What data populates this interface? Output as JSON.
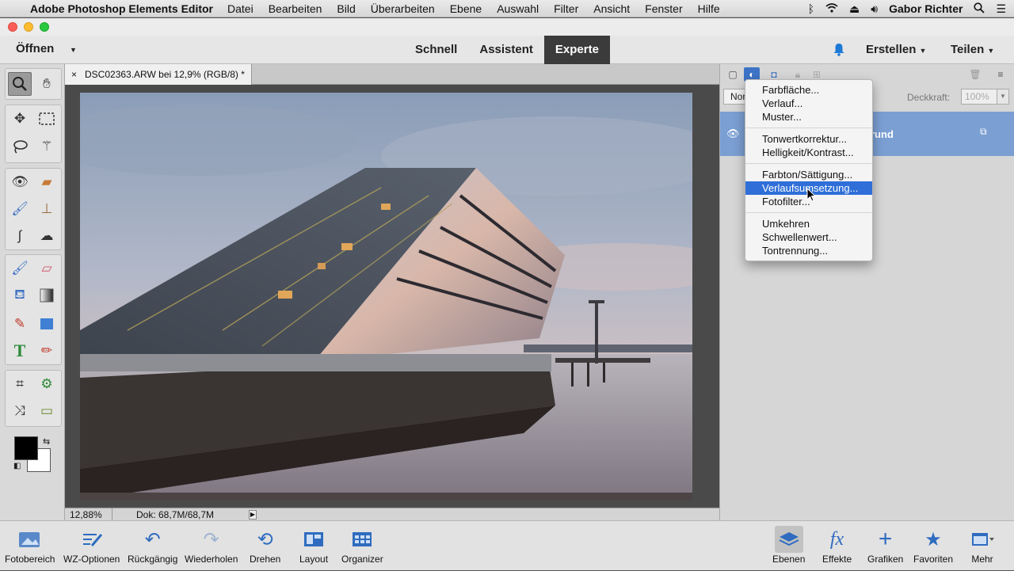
{
  "menubar": {
    "app_name": "Adobe Photoshop Elements Editor",
    "items": [
      "Datei",
      "Bearbeiten",
      "Bild",
      "Überarbeiten",
      "Ebene",
      "Auswahl",
      "Filter",
      "Ansicht",
      "Fenster",
      "Hilfe"
    ],
    "user": "Gabor Richter"
  },
  "apptoolbar": {
    "open_label": "Öffnen",
    "modes": [
      "Schnell",
      "Assistent",
      "Experte"
    ],
    "active_mode": "Experte",
    "create_label": "Erstellen",
    "share_label": "Teilen"
  },
  "document": {
    "tab_title": "DSC02363.ARW bei 12,9% (RGB/8) *",
    "zoom": "12,88%",
    "doc_size": "Dok: 68,7M/68,7M"
  },
  "layers_panel": {
    "blend_mode": "Nor",
    "opacity_label": "Deckkraft:",
    "opacity_value": "100%",
    "layer_name": "rund"
  },
  "adjustment_menu": {
    "groups": [
      [
        "Farbfläche...",
        "Verlauf...",
        "Muster..."
      ],
      [
        "Tonwertkorrektur...",
        "Helligkeit/Kontrast..."
      ],
      [
        "Farbton/Sättigung...",
        "Verlaufsumsetzung...",
        "Fotofilter..."
      ],
      [
        "Umkehren",
        "Schwellenwert...",
        "Tontrennung..."
      ]
    ],
    "highlighted": "Verlaufsumsetzung..."
  },
  "bottombar": {
    "left_items": [
      "Fotobereich",
      "WZ-Optionen",
      "Rückgängig",
      "Wiederholen",
      "Drehen",
      "Layout",
      "Organizer"
    ],
    "right_items": [
      "Ebenen",
      "Effekte",
      "Grafiken",
      "Favoriten",
      "Mehr"
    ],
    "active_right": "Ebenen"
  },
  "colors": {
    "accent": "#2f6fd7",
    "layer_selected": "#7b9fd3",
    "mode_active_bg": "#3b3b3b"
  }
}
